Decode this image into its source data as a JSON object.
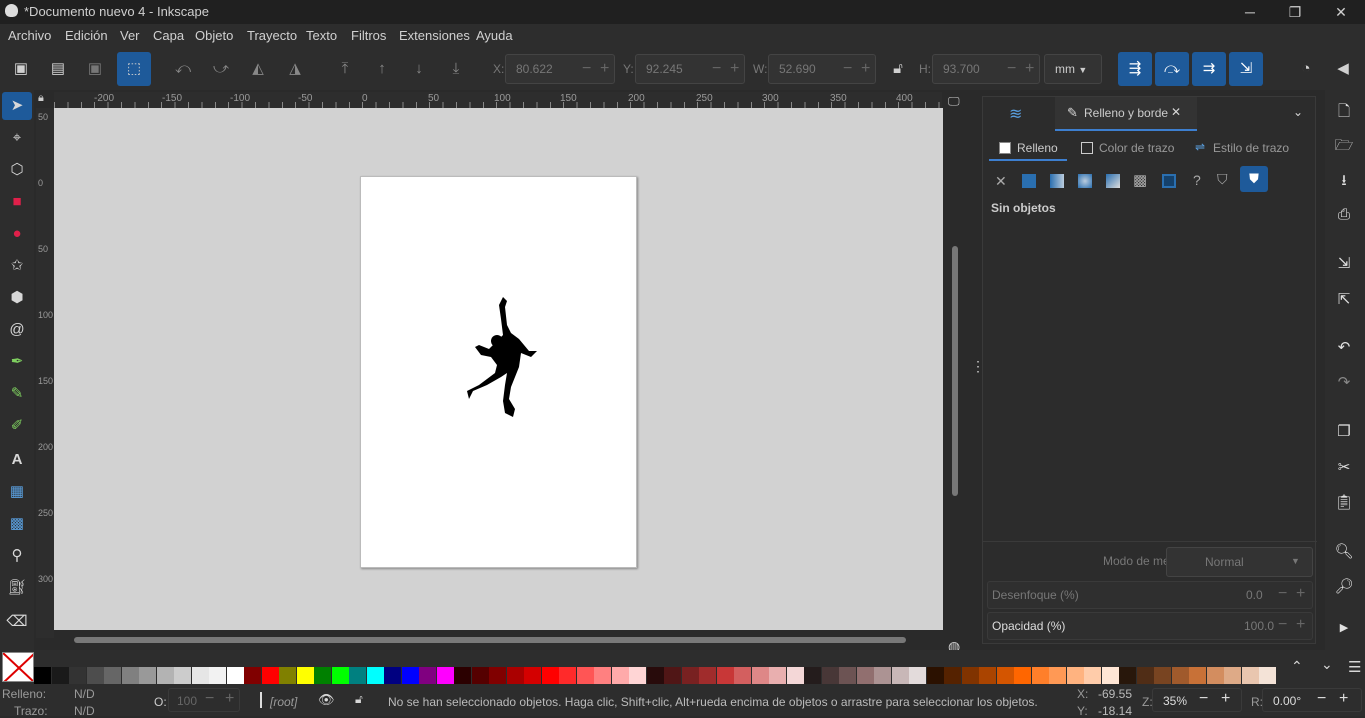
{
  "window": {
    "title": "*Documento nuevo 4 - Inkscape",
    "minimize": "─",
    "maximize": "❐",
    "close": "✕"
  },
  "menu": [
    "Archivo",
    "Edición",
    "Ver",
    "Capa",
    "Objeto",
    "Trayecto",
    "Texto",
    "Filtros",
    "Extensiones",
    "Ayuda"
  ],
  "toolbar": {
    "x_label": "X:",
    "x_value": "80.622",
    "y_label": "Y:",
    "y_value": "92.245",
    "w_label": "W:",
    "w_value": "52.690",
    "h_label": "H:",
    "h_value": "93.700",
    "unit": "mm"
  },
  "ruler_h": [
    "-200",
    "-150",
    "-100",
    "-50",
    "0",
    "50",
    "100",
    "150",
    "200",
    "250",
    "300",
    "350",
    "400"
  ],
  "ruler_v": [
    "50",
    "0",
    "50",
    "100",
    "150",
    "200",
    "250",
    "300"
  ],
  "panel": {
    "tab_layers_icon": "layers-icon",
    "tab_title": "Relleno y borde",
    "subtabs": [
      "Relleno",
      "Color de trazo",
      "Estilo de trazo"
    ],
    "no_objects": "Sin objetos",
    "blend_label": "Modo de mezcla:",
    "blend_value": "Normal",
    "blur_label": "Desenfoque (%)",
    "blur_value": "0.0",
    "opacity_label": "Opacidad (%)",
    "opacity_value": "100.0"
  },
  "palette_colors": [
    "#000000",
    "#1a1a1a",
    "#333333",
    "#4d4d4d",
    "#666666",
    "#808080",
    "#999999",
    "#b3b3b3",
    "#cccccc",
    "#e6e6e6",
    "#f2f2f2",
    "#ffffff",
    "#800000",
    "#ff0000",
    "#808000",
    "#ffff00",
    "#008000",
    "#00ff00",
    "#008080",
    "#00ffff",
    "#000080",
    "#0000ff",
    "#800080",
    "#ff00ff",
    "#2b0000",
    "#550000",
    "#800000",
    "#aa0000",
    "#d40000",
    "#ff0000",
    "#ff2a2a",
    "#ff5555",
    "#ff8080",
    "#ffaaaa",
    "#ffd5d5",
    "#280b0b",
    "#501616",
    "#782121",
    "#a02c2c",
    "#c83737",
    "#d35f5f",
    "#de8787",
    "#e9afaf",
    "#f4d7d7",
    "#241c1c",
    "#483737",
    "#6c5353",
    "#916f6f",
    "#ac9393",
    "#c8b7b7",
    "#e3dbdb",
    "#2b1100",
    "#552200",
    "#803300",
    "#aa4400",
    "#d45500",
    "#ff6600",
    "#ff7f2a",
    "#ff9955",
    "#ffb380",
    "#ffccaa",
    "#ffe6d5",
    "#28170b",
    "#502d16",
    "#784421",
    "#a05a2c",
    "#c87137",
    "#d38d5f",
    "#deaa87",
    "#e9c6af",
    "#f4e3d7"
  ],
  "status": {
    "fill_label": "Relleno:",
    "fill_value": "N/D",
    "stroke_label": "Trazo:",
    "stroke_value": "N/D",
    "opacity_label": "O:",
    "opacity_value": "100",
    "layer": "[root]",
    "message": "No se han seleccionado objetos. Haga clic, Shift+clic, Alt+rueda encima de objetos o arrastre para seleccionar los objetos.",
    "x_label": "X:",
    "x_value": "-69.55",
    "y_label": "Y:",
    "y_value": "-18.14",
    "zoom_label": "Z:",
    "zoom_value": "35%",
    "rot_label": "R:",
    "rot_value": "0.00°"
  }
}
